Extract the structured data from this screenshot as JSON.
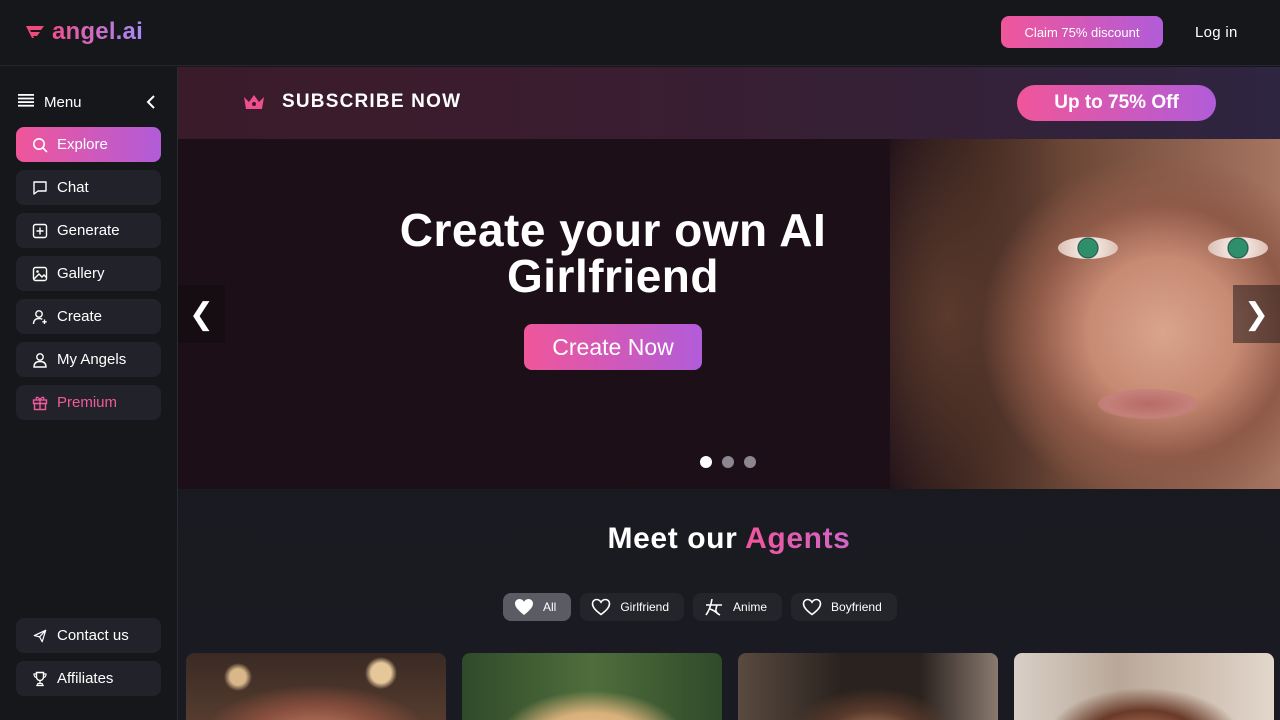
{
  "brand": {
    "name": "angel.ai",
    "accent": "#f0569a",
    "accent2": "#b15cd9"
  },
  "header": {
    "claim_label": "Claim 75% discount",
    "login_label": "Log in"
  },
  "sidebar": {
    "menu_label": "Menu",
    "items": [
      {
        "label": "Explore",
        "icon": "search-icon",
        "active": true
      },
      {
        "label": "Chat",
        "icon": "chat-icon"
      },
      {
        "label": "Generate",
        "icon": "plus-square-icon"
      },
      {
        "label": "Gallery",
        "icon": "image-icon"
      },
      {
        "label": "Create",
        "icon": "user-plus-icon"
      },
      {
        "label": "My Angels",
        "icon": "users-icon"
      },
      {
        "label": "Premium",
        "icon": "gift-icon"
      }
    ],
    "bottom": [
      {
        "label": "Contact us",
        "icon": "send-icon"
      },
      {
        "label": "Affiliates",
        "icon": "trophy-icon"
      }
    ]
  },
  "banner": {
    "text": "SUBSCRIBE NOW",
    "button": "Up to 75% Off"
  },
  "hero": {
    "title_line1": "Create your own AI",
    "title_line2": "Girlfriend",
    "button": "Create Now",
    "prev": "❮",
    "next": "❯",
    "slide_count": 3,
    "active_slide": 1
  },
  "agents": {
    "title_prefix": "Meet our",
    "title_accent": "Agents",
    "filters": [
      {
        "label": "All",
        "icon": "heart-filled-icon",
        "selected": true
      },
      {
        "label": "Girlfriend",
        "icon": "heart-icon"
      },
      {
        "label": "Anime",
        "icon": "kanji-icon"
      },
      {
        "label": "Boyfriend",
        "icon": "heart-icon"
      }
    ],
    "card_count": 4
  }
}
